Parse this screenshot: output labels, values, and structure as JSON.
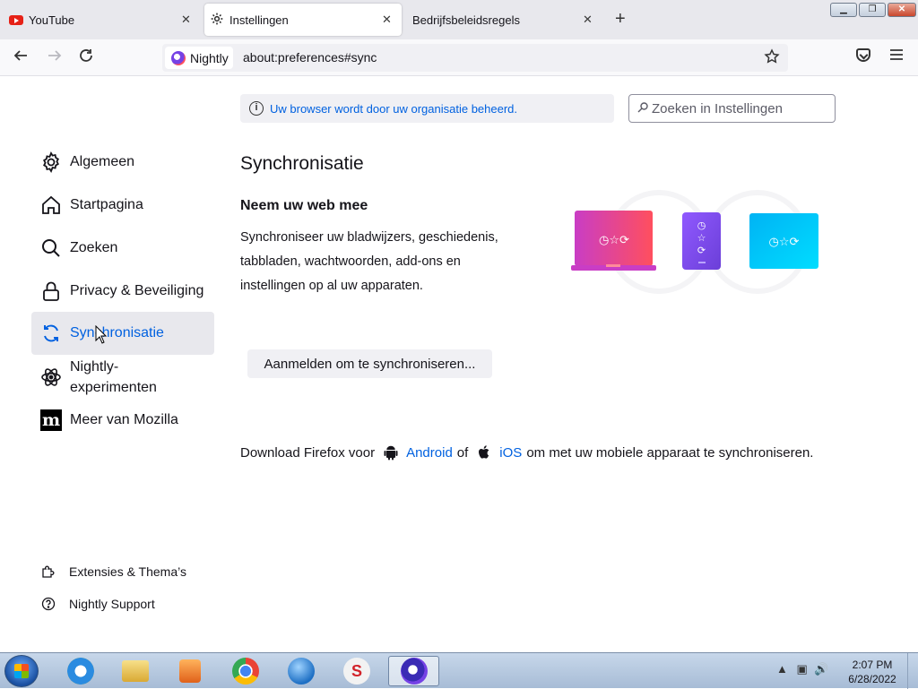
{
  "tabs": [
    {
      "title": "YouTube",
      "icon": "youtube-icon"
    },
    {
      "title": "Instellingen",
      "icon": "gear-icon",
      "active": true
    },
    {
      "title": "Bedrijfsbeleidsregels",
      "icon": ""
    }
  ],
  "tab_close_glyph": "✕",
  "new_tab_glyph": "+",
  "window_controls": {
    "min": "▁",
    "max": "❐",
    "close": "✕"
  },
  "urlbar": {
    "identity_label": "Nightly",
    "url": "about:preferences#sync"
  },
  "policy_banner": {
    "text": "Uw browser wordt door uw organisatie beheerd."
  },
  "search": {
    "placeholder": "Zoeken in Instellingen"
  },
  "sidebar": {
    "categories": [
      {
        "label": "Algemeen",
        "icon": "gear-icon"
      },
      {
        "label": "Startpagina",
        "icon": "home-icon"
      },
      {
        "label": "Zoeken",
        "icon": "search-icon"
      },
      {
        "label": "Privacy & Beveiliging",
        "icon": "lock-icon"
      },
      {
        "label": "Synchronisatie",
        "icon": "sync-icon",
        "selected": true
      },
      {
        "label": "Nightly-",
        "label2": "experimenten",
        "icon": "atom-icon"
      },
      {
        "label": "Meer van Mozilla",
        "icon": "mozilla-icon"
      }
    ],
    "footer": [
      {
        "label": "Extensies & Thema’s",
        "icon": "puzzle-icon"
      },
      {
        "label": "Nightly Support",
        "icon": "help-icon"
      }
    ]
  },
  "main": {
    "title": "Synchronisatie",
    "heading": "Neem uw web mee",
    "description": "Synchroniseer uw bladwijzers, geschiedenis, tabbladen, wachtwoorden, add-ons en instellingen op al uw apparaten.",
    "signin_button": "Aanmelden om te synchroniseren...",
    "download": {
      "prefix": "Download Firefox voor",
      "android": "Android",
      "of": "of",
      "ios": "iOS",
      "suffix": "om met uw mobiele apparaat te synchroniseren."
    }
  },
  "taskbar": {
    "apps": [
      "internet-explorer-icon",
      "file-explorer-icon",
      "media-player-icon",
      "chrome-icon",
      "globe-icon",
      "s-app-icon",
      "firefox-nightly-icon"
    ],
    "clock_time": "2:07 PM",
    "clock_date": "6/28/2022"
  },
  "colors": {
    "accent": "#0061e0",
    "selected_bg": "#e8e8ed",
    "tabstrip_bg": "#e8e8ed"
  }
}
